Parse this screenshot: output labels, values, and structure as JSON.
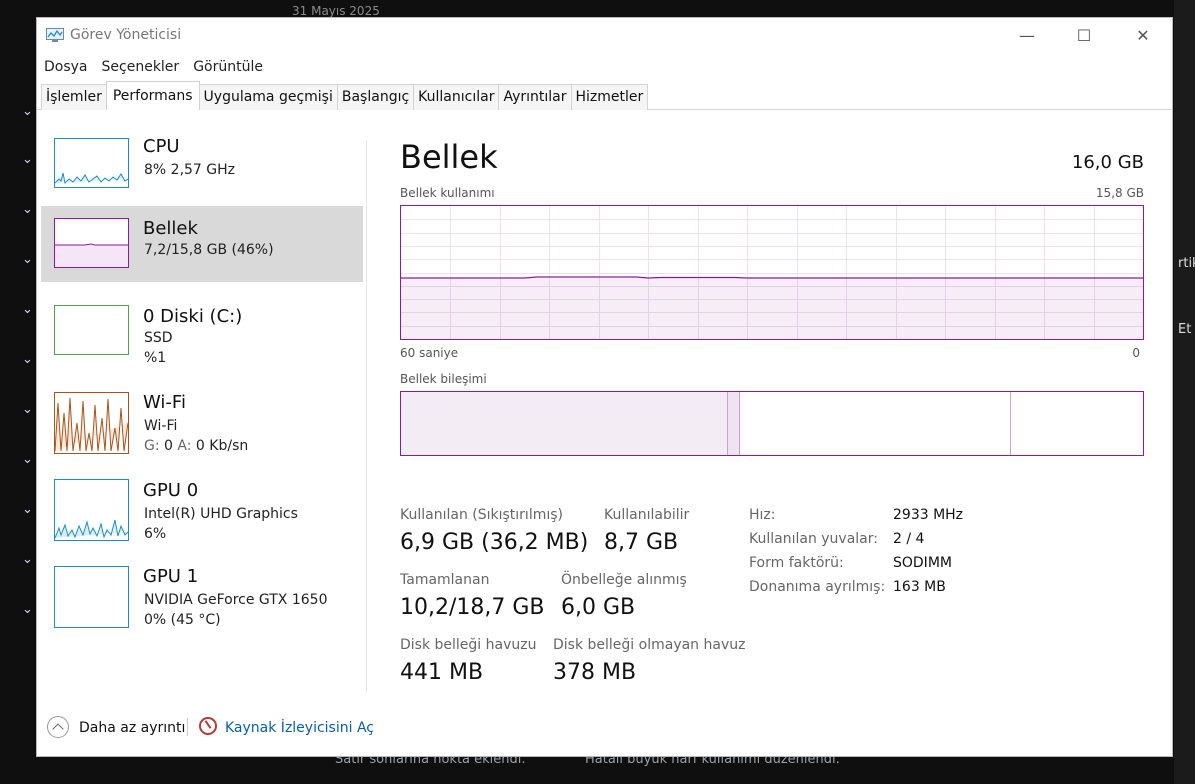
{
  "background": {
    "date": "31 Mayıs 2025",
    "footer_left": "Satır sonlarına nokta eklendi.",
    "footer_right": "Hatalı büyük harf kullanımı düzenlendi.",
    "right_text_1": "rtik",
    "right_text_2": "Et"
  },
  "window": {
    "title": "Görev Yöneticisi",
    "menu": [
      "Dosya",
      "Seçenekler",
      "Görüntüle"
    ],
    "tabs": [
      "İşlemler",
      "Performans",
      "Uygulama geçmişi",
      "Başlangıç",
      "Kullanıcılar",
      "Ayrıntılar",
      "Hizmetler"
    ],
    "active_tab": "Performans"
  },
  "sidebar": {
    "items": [
      {
        "name": "CPU",
        "line1": "8%  2,57 GHz",
        "line2": "",
        "color": "#1b8fc4"
      },
      {
        "name": "Bellek",
        "line1": "7,2/15,8 GB (46%)",
        "line2": "",
        "color": "#8b1a9b",
        "selected": true
      },
      {
        "name": "0 Diski (C:)",
        "line1": "SSD",
        "line2": "%1",
        "color": "#4da64a"
      },
      {
        "name": "Wi-Fi",
        "line1": "Wi-Fi",
        "line2_label_g": "G:",
        "line2_val_g": "0",
        "line2_label_a": "A:",
        "line2_val_a": "0 Kb/sn",
        "color": "#a8541a"
      },
      {
        "name": "GPU 0",
        "line1": "Intel(R) UHD Graphics",
        "line2": "6%",
        "color": "#1b8fc4"
      },
      {
        "name": "GPU 1",
        "line1": "NVIDIA GeForce GTX 1650",
        "line2": "0%  (45 °C)",
        "color": "#1b8fc4"
      }
    ]
  },
  "memory": {
    "title": "Bellek",
    "total": "16,0 GB",
    "usage_caption": "Bellek kullanımı",
    "usage_max": "15,8 GB",
    "x_left": "60 saniye",
    "x_right": "0",
    "composition_caption": "Bellek bileşimi",
    "usage_fraction": 0.46,
    "stats": {
      "used_label": "Kullanılan (Sıkıştırılmış)",
      "used_value": "6,9 GB (36,2 MB)",
      "available_label": "Kullanılabilir",
      "available_value": "8,7 GB",
      "committed_label": "Tamamlanan",
      "committed_value": "10,2/18,7 GB",
      "cached_label": "Önbelleğe alınmış",
      "cached_value": "6,0 GB",
      "paged_label": "Disk belleği havuzu",
      "paged_value": "441 MB",
      "nonpaged_label": "Disk belleği olmayan havuz",
      "nonpaged_value": "378 MB"
    },
    "details": {
      "speed_label": "Hız:",
      "speed_value": "2933 MHz",
      "slots_label": "Kullanılan yuvalar:",
      "slots_value": "2 / 4",
      "form_label": "Form faktörü:",
      "form_value": "SODIMM",
      "reserved_label": "Donanıma ayrılmış:",
      "reserved_value": "163 MB"
    }
  },
  "footer": {
    "fewer_details": "Daha az ayrıntı",
    "resource_monitor": "Kaynak İzleyicisini Aç"
  }
}
